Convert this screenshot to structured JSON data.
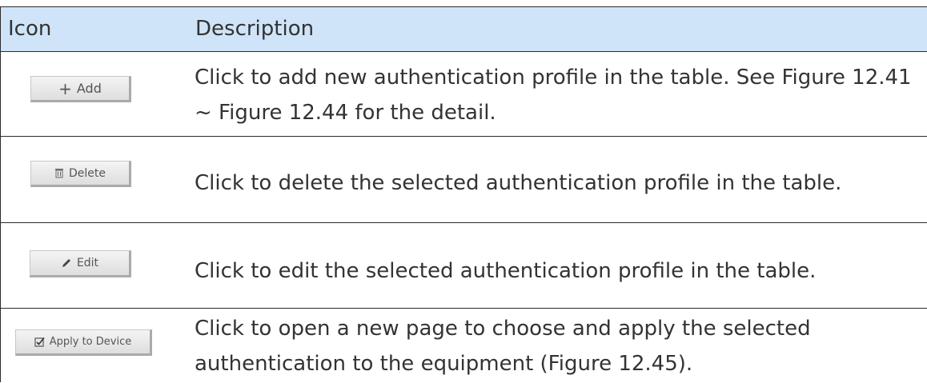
{
  "table": {
    "headers": {
      "icon": "Icon",
      "description": "Description"
    },
    "rows": [
      {
        "button_label": "Add",
        "button_icon": "plus-icon",
        "description": "Click to add new authentication profile in the table. See Figure 12.41 ~ Figure 12.44 for the detail."
      },
      {
        "button_label": "Delete",
        "button_icon": "trash-icon",
        "description": "Click to delete the selected authentication profile in the table."
      },
      {
        "button_label": "Edit",
        "button_icon": "pencil-icon",
        "description": "Click to edit the selected authentication profile in the table."
      },
      {
        "button_label": "Apply to Device",
        "button_icon": "checkbox-icon",
        "description": "Click to open a new page to choose and apply the selected authentication to the equipment (Figure 12.45)."
      }
    ]
  },
  "colors": {
    "header_background": "#cfe4f9",
    "text": "#333333",
    "border": "#2b2b2b"
  }
}
